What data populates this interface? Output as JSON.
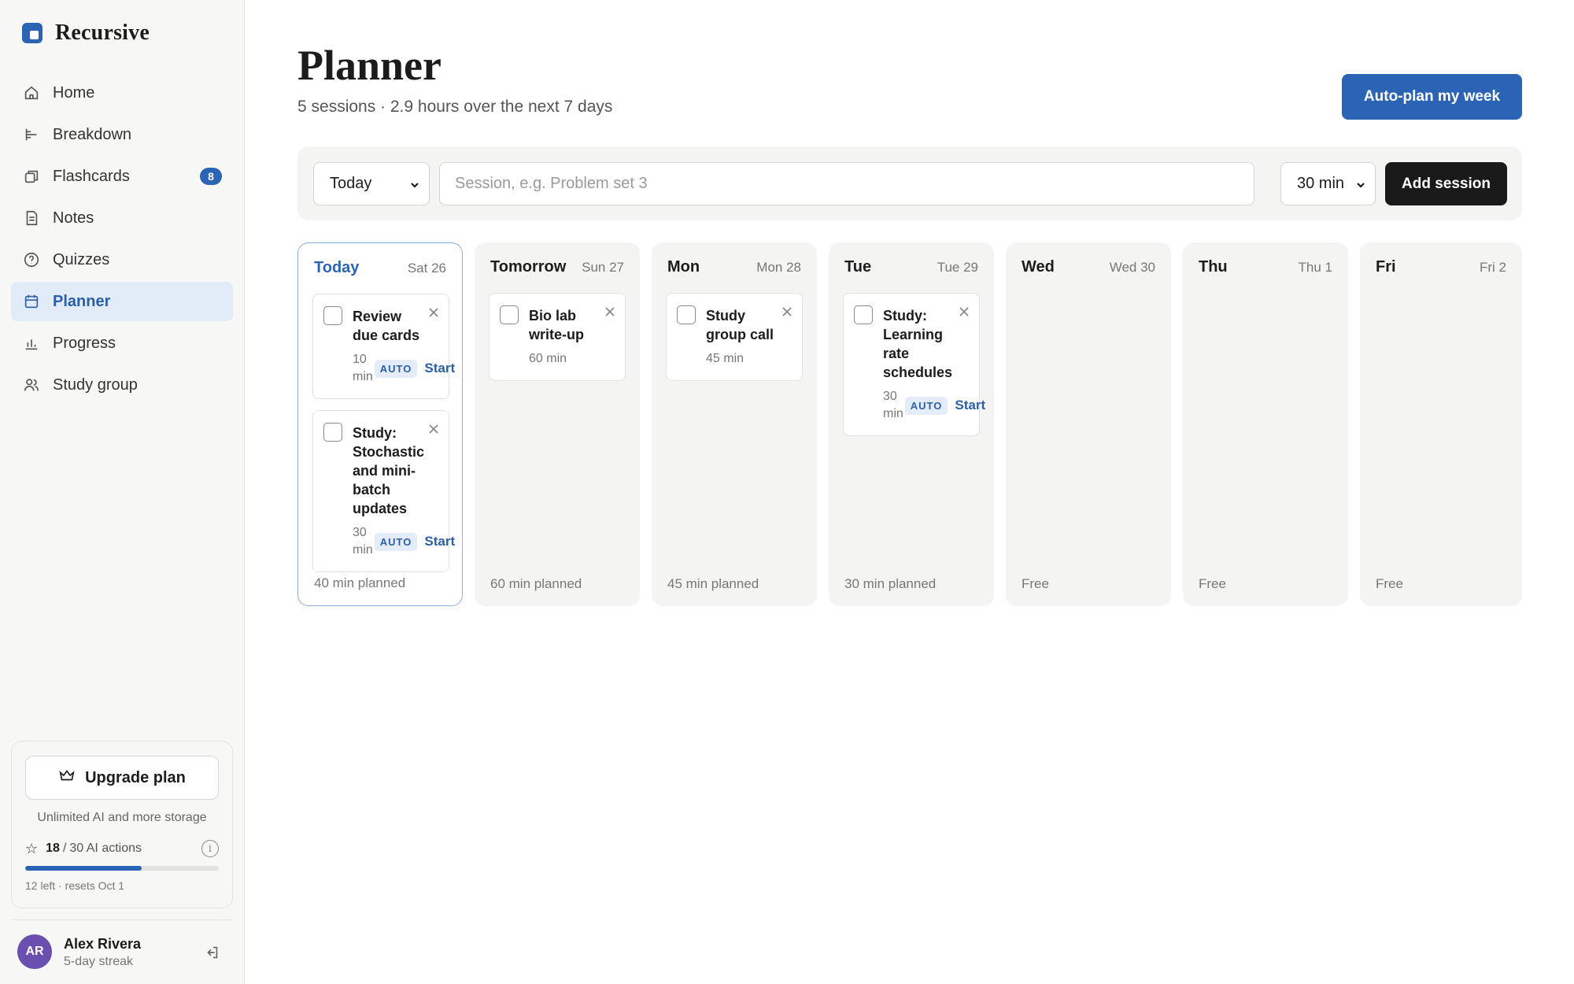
{
  "app": {
    "name": "Recursive",
    "colors": {
      "accent": "#2b63b5",
      "active_bg": "#e2ebf8",
      "dark_button": "#1a1a1a"
    }
  },
  "sidebar": {
    "items": [
      {
        "label": "Home",
        "icon": "home-icon"
      },
      {
        "label": "Breakdown",
        "icon": "breakdown-icon"
      },
      {
        "label": "Flashcards",
        "icon": "flashcards-icon",
        "badge": "8"
      },
      {
        "label": "Notes",
        "icon": "notes-icon"
      },
      {
        "label": "Quizzes",
        "icon": "quiz-icon"
      },
      {
        "label": "Planner",
        "icon": "calendar-icon",
        "active": true
      },
      {
        "label": "Progress",
        "icon": "bar-chart-icon"
      },
      {
        "label": "Study group",
        "icon": "users-icon"
      }
    ],
    "upgrade": {
      "button_label": "Upgrade plan",
      "subtitle": "Unlimited AI and more storage",
      "ai_used": "18",
      "ai_total_label": "30 AI actions",
      "ai_used_fraction": 0.6,
      "reset_note": "12 left · resets Oct 1"
    },
    "user": {
      "initials": "AR",
      "name": "Alex Rivera",
      "streak": "5-day streak"
    }
  },
  "header": {
    "title": "Planner",
    "subtitle": "5 sessions · 2.9 hours over the next 7 days",
    "autoplan_label": "Auto-plan my week"
  },
  "add_bar": {
    "day_value": "Today",
    "session_placeholder": "Session, e.g. Problem set 3",
    "duration_value": "30 min",
    "add_label": "Add session"
  },
  "week": [
    {
      "name": "Today",
      "date": "Sat 26",
      "footer": "40 min planned",
      "today": true,
      "sessions": [
        {
          "title": "Review due cards",
          "duration": "10 min",
          "auto": true,
          "auto_label": "AUTO",
          "start_label": "Start"
        },
        {
          "title": "Study: Stochastic and mini-batch updates",
          "duration": "30 min",
          "auto": true,
          "auto_label": "AUTO",
          "start_label": "Start"
        }
      ]
    },
    {
      "name": "Tomorrow",
      "date": "Sun 27",
      "footer": "60 min planned",
      "sessions": [
        {
          "title": "Bio lab write-up",
          "duration": "60 min",
          "auto": false
        }
      ]
    },
    {
      "name": "Mon",
      "date": "Mon 28",
      "footer": "45 min planned",
      "sessions": [
        {
          "title": "Study group call",
          "duration": "45 min",
          "auto": false
        }
      ]
    },
    {
      "name": "Tue",
      "date": "Tue 29",
      "footer": "30 min planned",
      "sessions": [
        {
          "title": "Study: Learning rate schedules",
          "duration": "30 min",
          "auto": true,
          "auto_label": "AUTO",
          "start_label": "Start"
        }
      ]
    },
    {
      "name": "Wed",
      "date": "Wed 30",
      "footer": "Free",
      "sessions": []
    },
    {
      "name": "Thu",
      "date": "Thu 1",
      "footer": "Free",
      "sessions": []
    },
    {
      "name": "Fri",
      "date": "Fri 2",
      "footer": "Free",
      "sessions": []
    }
  ]
}
